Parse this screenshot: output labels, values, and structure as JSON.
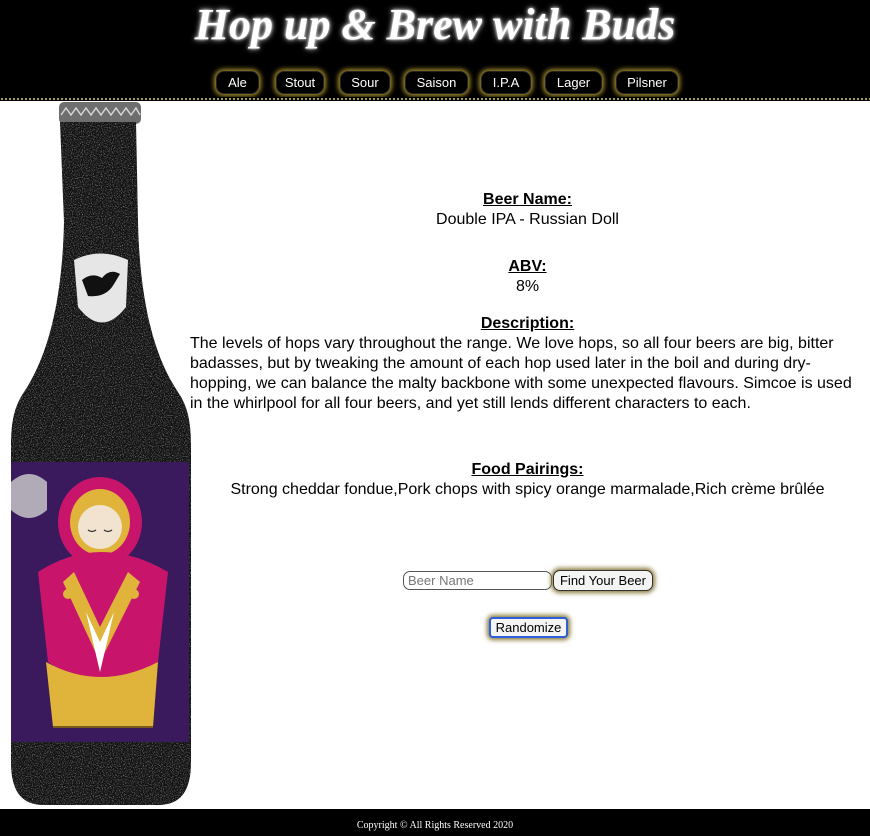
{
  "header": {
    "title": "Hop up & Brew with Buds",
    "nav": [
      {
        "label": "Ale"
      },
      {
        "label": "Stout"
      },
      {
        "label": "Sour"
      },
      {
        "label": "Saison"
      },
      {
        "label": "I.P.A"
      },
      {
        "label": "Lager"
      },
      {
        "label": "Pilsner"
      }
    ]
  },
  "beer": {
    "name_label": "Beer Name:",
    "name": "Double IPA - Russian Doll",
    "abv_label": "ABV:",
    "abv": "8%",
    "description_label": "Description:",
    "description": "The levels of hops vary throughout the range. We love hops, so all four beers are big, bitter badasses, but by tweaking the amount of each hop used later in the boil and during dry-hopping, we can balance the malty backbone with some unexpected flavours. Simcoe is used in the whirlpool for all four beers, and yet still lends different characters to each.",
    "food_label": "Food Pairings:",
    "food": "Strong cheddar fondue,Pork chops with spicy orange marmalade,Rich crème brûlée"
  },
  "search": {
    "placeholder": "Beer Name",
    "value": "",
    "find_label": "Find Your Beer",
    "randomize_label": "Randomize"
  },
  "footer": {
    "copyright": "Copyright © All Rights Reserved 2020"
  },
  "colors": {
    "header_bg": "#000000",
    "nav_glow": "#a28a2a",
    "label_purple": "#3a1a5c",
    "doll_pink": "#c8156b",
    "doll_gold": "#e0b43a"
  }
}
